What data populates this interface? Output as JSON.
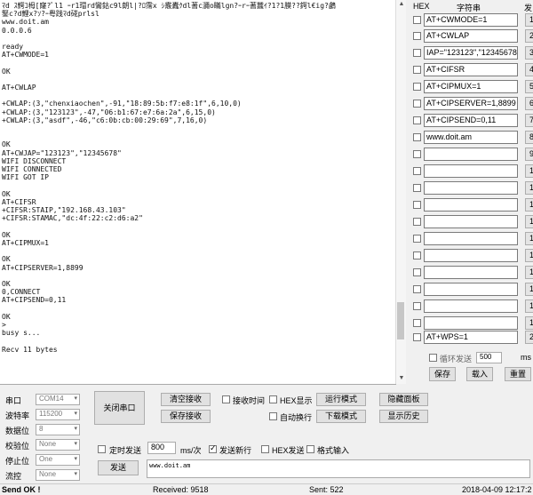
{
  "receive": {
    "text": "ﾏd ｽ鰐ｺ栂[窿?ﾟl1 ｰr1瑁rd鸞鈷c9l朗l|?ﾛ霈x ｼ霰蠹ｸdl蓍c瀰o瞞lgn?ｰrｰ蓍蠶ｲ?1?1膜??鍔l€ig?鸕\n鋻c?d鯉x?ｿ?ｰ粤践ﾏd硴prlsl\nwww.doit.am\n0.0.0.6\n\nready\nAT+CWMODE=1\n\nOK\n\nAT+CWLAP\n\n+CWLAP:(3,\"chenxiaochen\",-91,\"18:89:5b:f7:e8:1f\",6,10,0)\n+CWLAP:(3,\"123123\",-47,\"06:b1:67:e7:6a:2a\",6,15,0)\n+CWLAP:(3,\"asdf\",-46,\"c6:0b:cb:00:29:69\",7,16,0)\n\n\nOK\nAT+CWJAP=\"123123\",\"12345678\"\nWIFI DISCONNECT\nWIFI CONNECTED\nWIFI GOT IP\n\nOK\nAT+CIFSR\n+CIFSR:STAIP,\"192.168.43.103\"\n+CIFSR:STAMAC,\"dc:4f:22:c2:d6:a2\"\n\nOK\nAT+CIPMUX=1\n\nOK\nAT+CIPSERVER=1,8899\n\nOK\n0,CONNECT\nAT+CIPSEND=0,11\n\nOK\n>\nbusy s...\n\nRecv 11 bytes"
  },
  "multi": {
    "header_hex": "HEX",
    "header_str": "字符串",
    "header_send": "发",
    "rows": [
      {
        "value": "AT+CWMODE=1",
        "n": "1"
      },
      {
        "value": "AT+CWLAP",
        "n": "2"
      },
      {
        "value": "IAP=\"123123\",\"12345678\"",
        "n": "3"
      },
      {
        "value": "AT+CIFSR",
        "n": "4"
      },
      {
        "value": "AT+CIPMUX=1",
        "n": "5"
      },
      {
        "value": "AT+CIPSERVER=1,8899",
        "n": "6"
      },
      {
        "value": "AT+CIPSEND=0,11",
        "n": "7"
      },
      {
        "value": "www.doit.am",
        "n": "8"
      },
      {
        "value": "",
        "n": "9"
      },
      {
        "value": "",
        "n": "1"
      },
      {
        "value": "",
        "n": "1"
      },
      {
        "value": "",
        "n": "1"
      },
      {
        "value": "",
        "n": "1"
      },
      {
        "value": "",
        "n": "1"
      },
      {
        "value": "",
        "n": "1"
      },
      {
        "value": "",
        "n": "1"
      },
      {
        "value": "",
        "n": "1"
      },
      {
        "value": "",
        "n": "1"
      },
      {
        "value": "",
        "n": "1"
      },
      {
        "value": "AT+WPS=1",
        "n": "2"
      }
    ],
    "loop_label": "循环发送",
    "loop_ms": "500",
    "ms_unit": "ms",
    "save_label": "保存",
    "load_label": "载入",
    "reset_label": "重置"
  },
  "port": {
    "port_label": "串口",
    "port_value": "COM14",
    "baud_label": "波特率",
    "baud_value": "115200",
    "data_label": "数据位",
    "data_value": "8",
    "parity_label": "校验位",
    "parity_value": "None",
    "stop_label": "停止位",
    "stop_value": "One",
    "flow_label": "流控",
    "flow_value": "None",
    "close_label": "关闭串口"
  },
  "controls": {
    "clear_recv": "清空接收",
    "save_recv": "保存接收",
    "recv_time": "接收时间",
    "hex_show": "HEX显示",
    "auto_wrap": "自动换行",
    "run_mode": "运行模式",
    "download_mode": "下载模式",
    "hide_panel": "隐藏面板",
    "show_history": "显示历史"
  },
  "send": {
    "timed_label": "定时发送",
    "interval": "800",
    "interval_unit": "ms/次",
    "newline_label": "发送新行",
    "hex_send_label": "HEX发送",
    "format_input_label": "格式输入",
    "send_label": "发送",
    "input_value": "www.doit.am"
  },
  "status": {
    "send_ok": "Send OK !",
    "received": "Received: 9518",
    "sent": "Sent: 522",
    "time": "2018-04-09 12:17:2"
  }
}
